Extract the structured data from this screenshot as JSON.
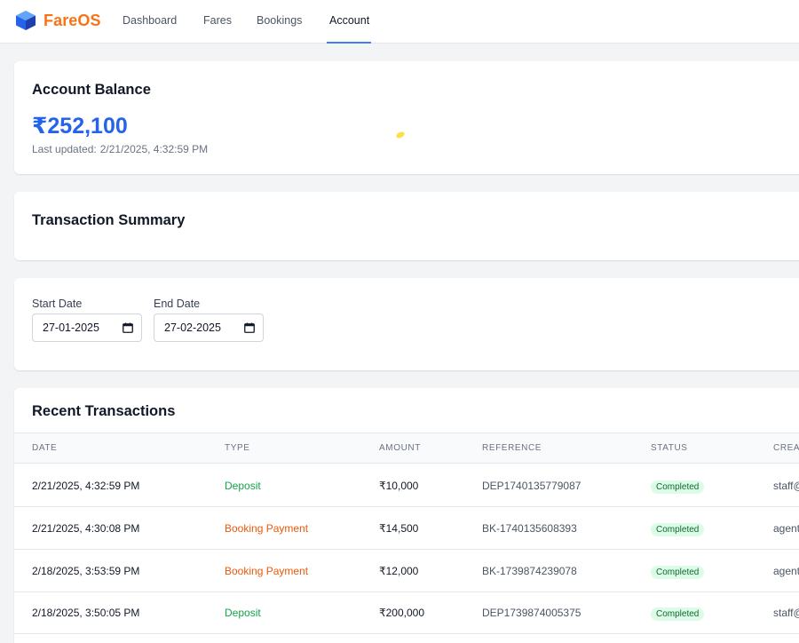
{
  "brand": {
    "name": "FareOS"
  },
  "nav": {
    "links": [
      {
        "label": "Dashboard"
      },
      {
        "label": "Fares"
      },
      {
        "label": "Bookings"
      },
      {
        "label": "Account"
      }
    ],
    "active": "Account"
  },
  "balance": {
    "title": "Account Balance",
    "amount": "₹252,100",
    "last_updated_label": "Last updated:",
    "last_updated_value": "2/21/2025, 4:32:59 PM"
  },
  "summary": {
    "title": "Transaction Summary"
  },
  "filters": {
    "start_label": "Start Date",
    "start_value": "27-01-2025",
    "end_label": "End Date",
    "end_value": "27-02-2025"
  },
  "transactions": {
    "title": "Recent Transactions",
    "headers": [
      "Date",
      "Type",
      "Amount",
      "Reference",
      "Status",
      "Creat"
    ],
    "rows": [
      {
        "date": "2/21/2025, 4:32:59 PM",
        "type": "Deposit",
        "amount": "₹10,000",
        "reference": "DEP1740135779087",
        "status": "Completed",
        "created": "staff@"
      },
      {
        "date": "2/21/2025, 4:30:08 PM",
        "type": "Booking Payment",
        "amount": "₹14,500",
        "reference": "BK-1740135608393",
        "status": "Completed",
        "created": "agent"
      },
      {
        "date": "2/18/2025, 3:53:59 PM",
        "type": "Booking Payment",
        "amount": "₹12,000",
        "reference": "BK-1739874239078",
        "status": "Completed",
        "created": "agent"
      },
      {
        "date": "2/18/2025, 3:50:05 PM",
        "type": "Deposit",
        "amount": "₹200,000",
        "reference": "DEP1739874005375",
        "status": "Completed",
        "created": "staff@"
      }
    ]
  },
  "colors": {
    "brand_orange": "#f97316",
    "accent_blue": "#2563eb",
    "deposit_green": "#16a34a",
    "booking_orange": "#ea580c",
    "badge_bg": "#dcfce7"
  },
  "icons": {
    "brand": "cube-icon",
    "date": "calendar-icon"
  }
}
